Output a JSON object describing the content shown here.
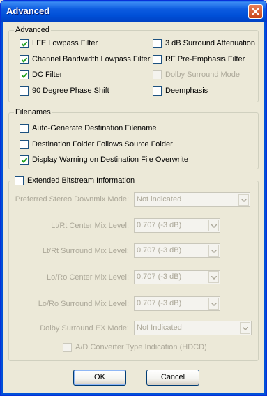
{
  "window": {
    "title": "Advanced"
  },
  "advanced": {
    "label": "Advanced",
    "items": [
      {
        "label": "LFE Lowpass Filter",
        "checked": true,
        "enabled": true
      },
      {
        "label": "Channel Bandwidth Lowpass Filter",
        "checked": true,
        "enabled": true
      },
      {
        "label": "DC Filter",
        "checked": true,
        "enabled": true
      },
      {
        "label": "90 Degree Phase Shift",
        "checked": false,
        "enabled": true
      },
      {
        "label": "3 dB Surround Attenuation",
        "checked": false,
        "enabled": true
      },
      {
        "label": "RF Pre-Emphasis Filter",
        "checked": false,
        "enabled": true
      },
      {
        "label": "Dolby Surround Mode",
        "checked": false,
        "enabled": false
      },
      {
        "label": "Deemphasis",
        "checked": false,
        "enabled": true
      }
    ]
  },
  "filenames": {
    "label": "Filenames",
    "items": [
      {
        "label": "Auto-Generate Destination Filename",
        "checked": false,
        "enabled": true
      },
      {
        "label": "Destination Folder Follows Source Folder",
        "checked": false,
        "enabled": true
      },
      {
        "label": "Display Warning on Destination File Overwrite",
        "checked": true,
        "enabled": true
      }
    ]
  },
  "bitstream": {
    "label": "Extended Bitstream Information",
    "checked": false,
    "fields": [
      {
        "label": "Preferred Stereo Downmix Mode:",
        "value": "Not indicated"
      },
      {
        "label": "Lt/Rt Center Mix Level:",
        "value": "0.707 (-3 dB)"
      },
      {
        "label": "Lt/Rt Surround Mix Level:",
        "value": "0.707 (-3 dB)"
      },
      {
        "label": "Lo/Ro Center Mix Level:",
        "value": "0.707 (-3 dB)"
      },
      {
        "label": "Lo/Ro Surround Mix Level:",
        "value": "0.707 (-3 dB)"
      },
      {
        "label": "Dolby Surround EX Mode:",
        "value": "Not Indicated"
      }
    ],
    "ad_converter": {
      "label": "A/D Converter Type Indication (HDCD)",
      "checked": false,
      "enabled": false
    }
  },
  "buttons": {
    "ok": "OK",
    "cancel": "Cancel"
  }
}
